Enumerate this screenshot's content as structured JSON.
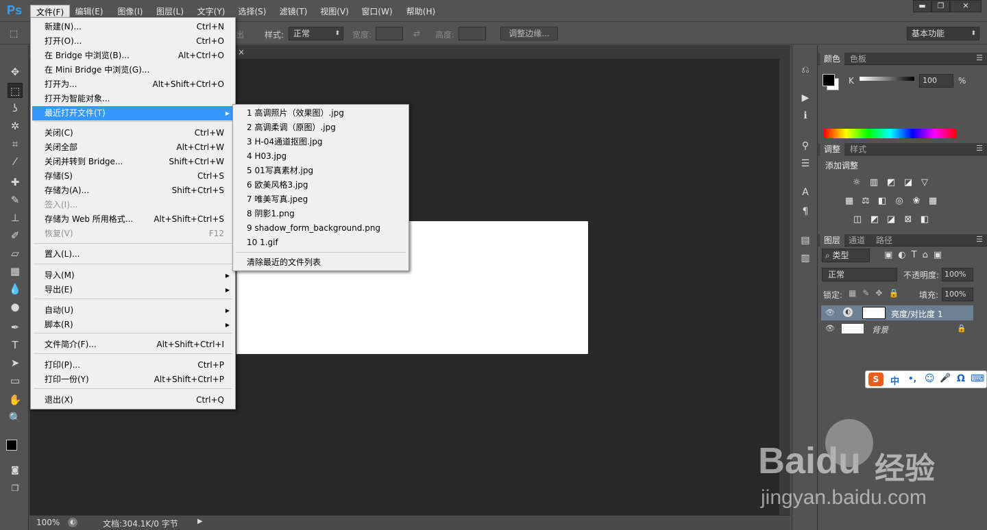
{
  "app": {
    "logo": "Ps"
  },
  "menubar": {
    "items": [
      "文件(F)",
      "编辑(E)",
      "图像(I)",
      "图层(L)",
      "文字(Y)",
      "选择(S)",
      "滤镜(T)",
      "视图(V)",
      "窗口(W)",
      "帮助(H)"
    ]
  },
  "window_controls": {
    "minimize": "▬",
    "restore": "❐",
    "close": "✕"
  },
  "options": {
    "partial_label": "出",
    "style_label": "样式:",
    "style_value": "正常",
    "width_label": "宽度:",
    "height_label": "高度:",
    "refine_label": "调整边缘...",
    "workspace": "基本功能"
  },
  "file_menu": {
    "items": [
      {
        "label": "新建(N)...",
        "shortcut": "Ctrl+N",
        "disabled": false
      },
      {
        "label": "打开(O)...",
        "shortcut": "Ctrl+O",
        "disabled": false
      },
      {
        "label": "在 Bridge 中浏览(B)...",
        "shortcut": "Alt+Ctrl+O",
        "disabled": false
      },
      {
        "label": "在 Mini Bridge 中浏览(G)...",
        "shortcut": "",
        "disabled": false
      },
      {
        "label": "打开为...",
        "shortcut": "Alt+Shift+Ctrl+O",
        "disabled": false
      },
      {
        "label": "打开为智能对象...",
        "shortcut": "",
        "disabled": false
      },
      {
        "label": "最近打开文件(T)",
        "shortcut": "",
        "disabled": false,
        "submenu": true,
        "highlighted": true
      },
      {
        "label": "关闭(C)",
        "shortcut": "Ctrl+W",
        "disabled": false
      },
      {
        "label": "关闭全部",
        "shortcut": "Alt+Ctrl+W",
        "disabled": false
      },
      {
        "label": "关闭并转到 Bridge...",
        "shortcut": "Shift+Ctrl+W",
        "disabled": false
      },
      {
        "label": "存储(S)",
        "shortcut": "Ctrl+S",
        "disabled": false
      },
      {
        "label": "存储为(A)...",
        "shortcut": "Shift+Ctrl+S",
        "disabled": false
      },
      {
        "label": "签入(I)...",
        "shortcut": "",
        "disabled": true
      },
      {
        "label": "存储为 Web 所用格式...",
        "shortcut": "Alt+Shift+Ctrl+S",
        "disabled": false
      },
      {
        "label": "恢复(V)",
        "shortcut": "F12",
        "disabled": true
      },
      {
        "label": "置入(L)...",
        "shortcut": "",
        "disabled": false
      },
      {
        "label": "导入(M)",
        "shortcut": "",
        "disabled": false,
        "submenu": true
      },
      {
        "label": "导出(E)",
        "shortcut": "",
        "disabled": false,
        "submenu": true
      },
      {
        "label": "自动(U)",
        "shortcut": "",
        "disabled": false,
        "submenu": true
      },
      {
        "label": "脚本(R)",
        "shortcut": "",
        "disabled": false,
        "submenu": true
      },
      {
        "label": "文件简介(F)...",
        "shortcut": "Alt+Shift+Ctrl+I",
        "disabled": false
      },
      {
        "label": "打印(P)...",
        "shortcut": "Ctrl+P",
        "disabled": false
      },
      {
        "label": "打印一份(Y)",
        "shortcut": "Alt+Shift+Ctrl+P",
        "disabled": false
      },
      {
        "label": "退出(X)",
        "shortcut": "Ctrl+Q",
        "disabled": false
      }
    ]
  },
  "recent_menu": {
    "items": [
      "1  高调照片（效果图）.jpg",
      "2  高调柔调（原图）.jpg",
      "3  H-04通道抠图.jpg",
      "4  H03.jpg",
      "5  01写真素材.jpg",
      "6  欧美风格3.jpg",
      "7  唯美写真.jpeg",
      "8  阴影1.png",
      "9  shadow_form_background.png",
      "10  1.gif"
    ],
    "clear": "清除最近的文件列表"
  },
  "doc_tab": {
    "close": "×"
  },
  "status": {
    "zoom": "100%",
    "doc_info": "文档:304.1K/0 字节"
  },
  "color_panel": {
    "tabs": [
      "颜色",
      "色板"
    ],
    "channel": "K",
    "value": "100",
    "unit": "%"
  },
  "adjust_panel": {
    "tabs": [
      "调整",
      "样式"
    ],
    "title": "添加调整"
  },
  "layers_panel": {
    "tabs": [
      "图层",
      "通道",
      "路径"
    ],
    "filter": "类型",
    "blend": "正常",
    "opacity_label": "不透明度:",
    "opacity": "100%",
    "lock_label": "锁定:",
    "fill_label": "填充:",
    "fill": "100%",
    "layers": [
      {
        "name": "亮度/对比度 1"
      },
      {
        "name": "背景"
      }
    ]
  },
  "ime": {
    "items": [
      "中",
      "•,",
      "☺",
      "🎤",
      "Ω",
      "⌨"
    ]
  },
  "watermark": {
    "brand_a": "Bai",
    "brand_b": "du",
    "cn": "经验",
    "url": "jingyan.baidu.com"
  }
}
